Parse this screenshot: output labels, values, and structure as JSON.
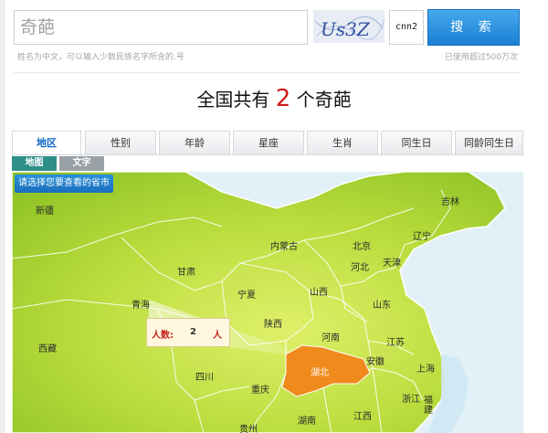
{
  "search": {
    "value": "奇葩",
    "captcha_text": "Us3Z",
    "code_value": "cnn2",
    "button_label": "搜 索"
  },
  "hint": "姓名为中文，可以输入少数民族名字所含的.号",
  "usage": "已使用超过500万次",
  "headline": {
    "prefix": "全国共有",
    "count": "2",
    "suffix": "个奇葩"
  },
  "tabs": [
    "地区",
    "性别",
    "年龄",
    "星座",
    "生肖",
    "同生日",
    "同龄同生日"
  ],
  "subtabs": [
    "地图",
    "文字"
  ],
  "map": {
    "choose_label": "请选择您要查看的省市",
    "tooltip": {
      "label": "人数:",
      "count": "2",
      "unit": "人"
    },
    "highlight_color": "#f08a1c",
    "provinces": [
      "新疆",
      "吉林",
      "辽宁",
      "内蒙古",
      "北京",
      "天津",
      "甘肃",
      "河北",
      "宁夏",
      "山西",
      "青海",
      "山东",
      "陕西",
      "河南",
      "江苏",
      "西藏",
      "湖北",
      "安徽",
      "上海",
      "四川",
      "重庆",
      "浙江",
      "湖南",
      "江西",
      "贵州",
      "福建"
    ]
  }
}
